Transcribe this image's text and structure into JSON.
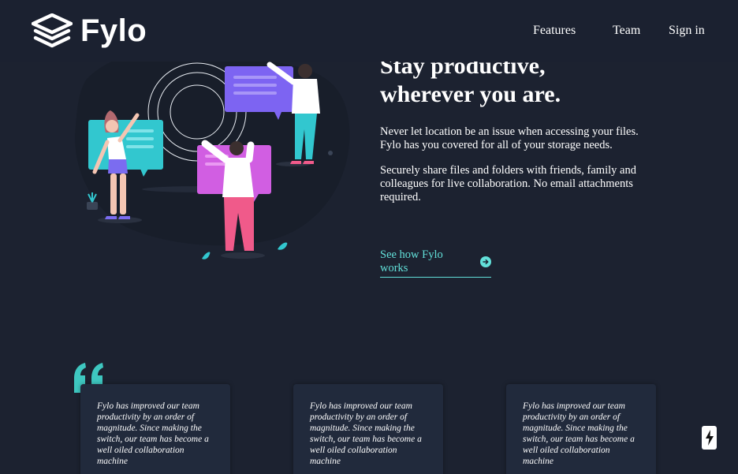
{
  "brand": {
    "name": "Fylo"
  },
  "nav": {
    "items": [
      "Features",
      "Team",
      "Sign in"
    ]
  },
  "hero": {
    "title": "Stay productive, wherever you are.",
    "paragraph_1": "Never let location be an issue when accessing your files. Fylo has you covered for all of your storage needs.",
    "paragraph_2": "Securely share files and folders with friends, family and colleagues for live collaboration. No email attachments required.",
    "link_label": "See how Fylo works"
  },
  "testimonials": [
    {
      "quote": "Fylo has improved our team productivity by an order of magnitude. Since making the switch, our team has become a well oiled collaboration machine"
    },
    {
      "quote": "Fylo has improved our team productivity by an order of magnitude. Since making the switch, our team has become a well oiled collaboration machine"
    },
    {
      "quote": "Fylo has improved our team productivity by an order of magnitude. Since making the switch, our team has become a well oiled collaboration machine"
    }
  ],
  "colors": {
    "background": "#1c2230",
    "header": "#1b2130",
    "accent": "#62e0d9",
    "card": "#212a3c"
  },
  "icons": {
    "logo": "stacked-layers-icon",
    "link": "arrow-right-circle-icon",
    "quote": "quote-mark-icon",
    "badge": "lightning-bolt-icon"
  }
}
